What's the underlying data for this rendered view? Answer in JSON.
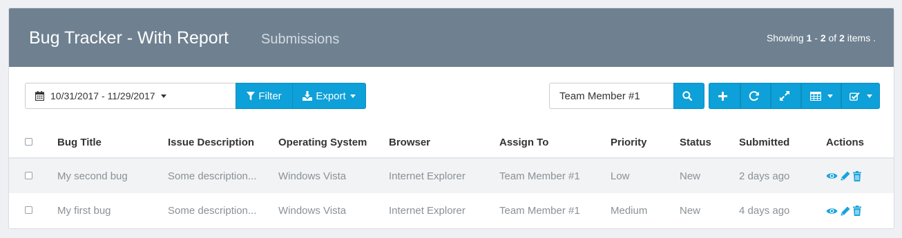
{
  "header": {
    "title": "Bug Tracker - With Report",
    "subtitle": "Submissions",
    "showing_prefix": "Showing ",
    "range_start": "1",
    "range_sep": " - ",
    "range_end": "2",
    "of": " of ",
    "total": "2",
    "suffix": " items ."
  },
  "toolbar": {
    "date_range": "10/31/2017 - 11/29/2017",
    "filter_label": "Filter",
    "export_label": "Export",
    "search_value": "Team Member #1"
  },
  "table": {
    "columns": [
      "Bug Title",
      "Issue Description",
      "Operating System",
      "Browser",
      "Assign To",
      "Priority",
      "Status",
      "Submitted",
      "Actions"
    ],
    "rows": [
      [
        "My second bug",
        "Some description...",
        "Windows Vista",
        "Internet Explorer",
        "Team Member #1",
        "Low",
        "New",
        "2 days ago"
      ],
      [
        "My first bug",
        "Some description...",
        "Windows Vista",
        "Internet Explorer",
        "Team Member #1",
        "Medium",
        "New",
        "4 days ago"
      ]
    ]
  },
  "colors": {
    "header_bg": "#6f8191",
    "accent": "#0ea0d8",
    "action_icon": "#1aa3dc"
  }
}
